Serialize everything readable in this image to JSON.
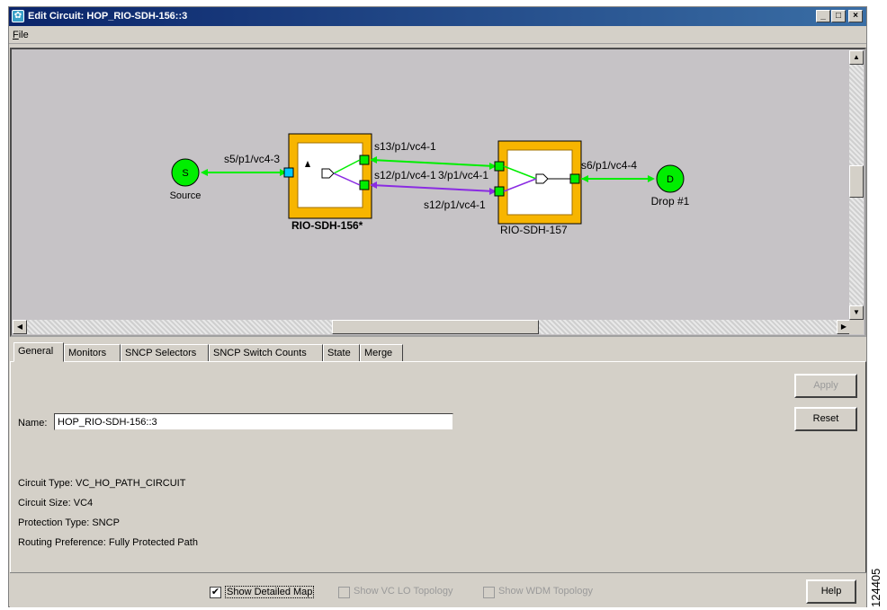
{
  "window": {
    "title": "Edit Circuit: HOP_RIO-SDH-156::3",
    "minimize": "_",
    "maximize": "□",
    "close": "×"
  },
  "menu": {
    "file": "File"
  },
  "map": {
    "source": {
      "letter": "S",
      "label": "Source",
      "port": "s5/p1/vc4-3"
    },
    "node1": {
      "label": "RIO-SDH-156*"
    },
    "node2": {
      "label": "RIO-SDH-157"
    },
    "links": {
      "top_label": "s13/p1/vc4-1",
      "middle_label": "s12/p1/vc4-1",
      "middle_overlap": "3/p1/vc4-1",
      "bottom_label": "s12/p1/vc4-1"
    },
    "drop": {
      "letter": "D",
      "label": "Drop #1",
      "port": "s6/p1/vc4-4"
    },
    "colors": {
      "green": "#00ee00",
      "purple": "#8a2be2",
      "node": "#f7b500",
      "cyan": "#00c8ff"
    }
  },
  "tabs": [
    "General",
    "Monitors",
    "SNCP Selectors",
    "SNCP Switch Counts",
    "State",
    "Merge"
  ],
  "general": {
    "name_label": "Name:",
    "name_value": "HOP_RIO-SDH-156::3",
    "circuit_type": "Circuit Type:  VC_HO_PATH_CIRCUIT",
    "circuit_size": "Circuit Size: VC4",
    "protection_type": "Protection Type:  SNCP",
    "routing_preference": "Routing Preference: Fully Protected Path",
    "apply_label": "Apply",
    "reset_label": "Reset"
  },
  "bottom": {
    "show_detailed_map": "Show Detailed Map",
    "show_vc_lo": "Show VC LO Topology",
    "show_wdm": "Show WDM Topology",
    "help_label": "Help",
    "checked_mark": "✔"
  },
  "figure_code": "124405"
}
